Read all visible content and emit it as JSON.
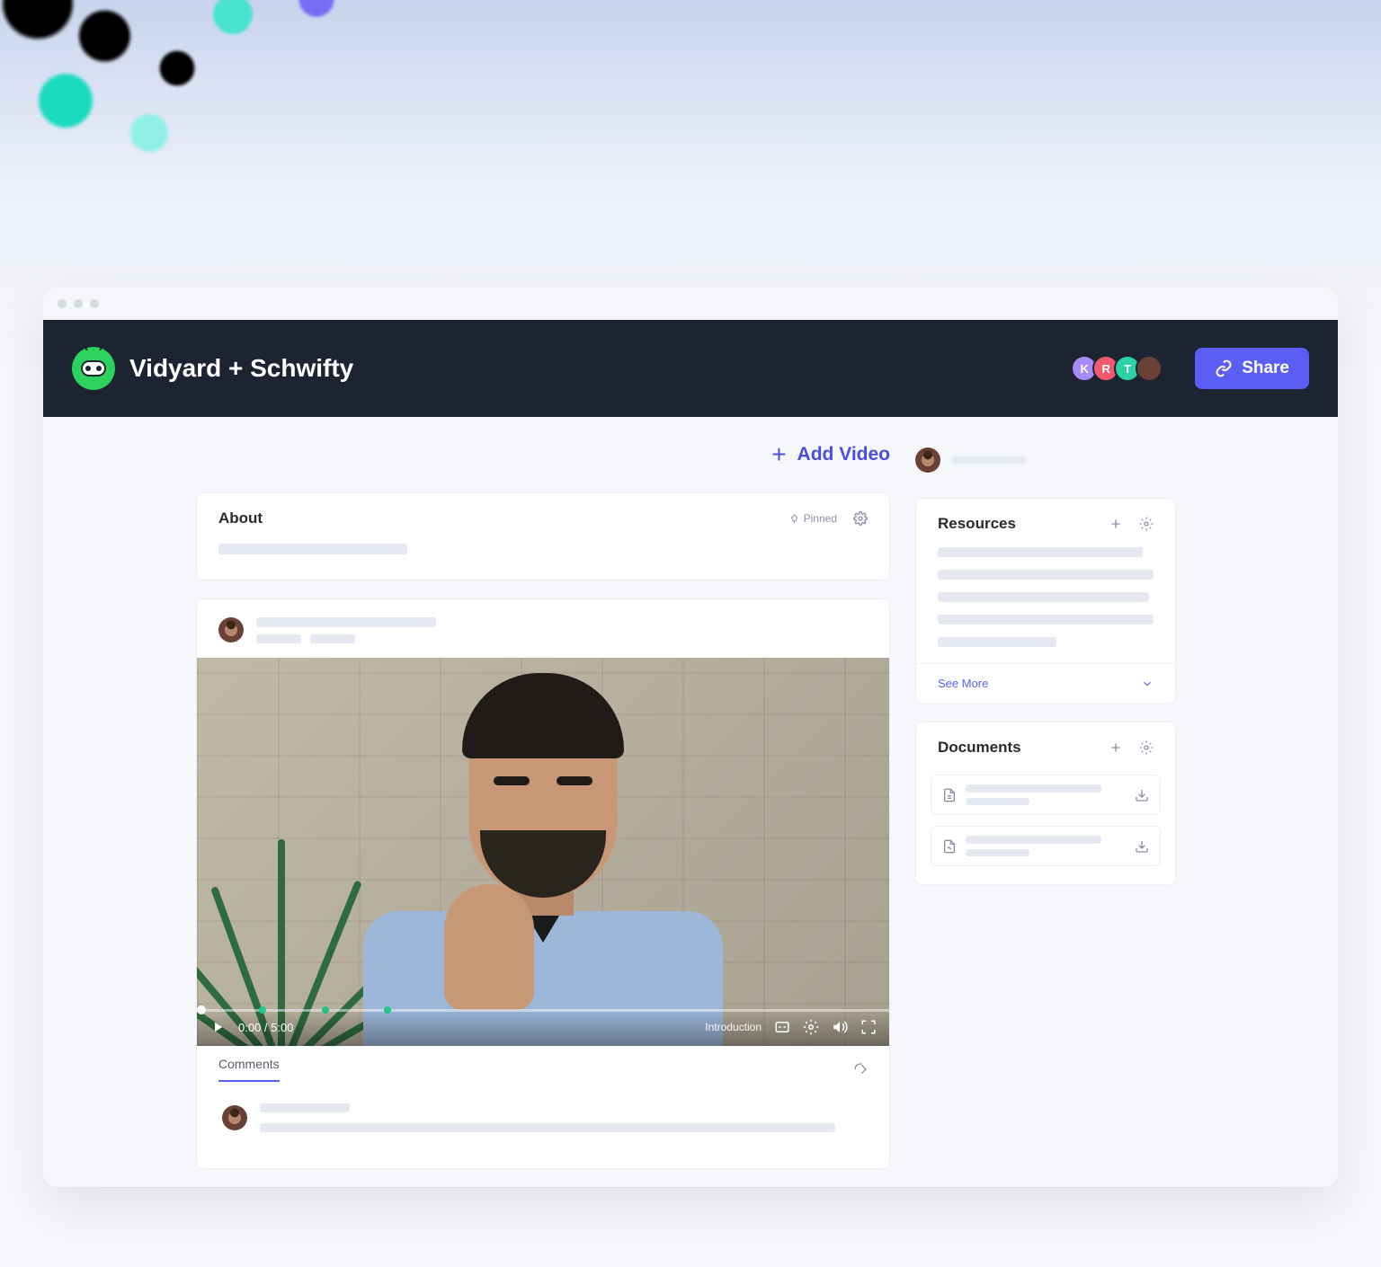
{
  "header": {
    "title": "Vidyard + Schwifty",
    "avatars": [
      "K",
      "R",
      "T"
    ],
    "share_label": "Share"
  },
  "toolbar": {
    "add_video": "Add Video"
  },
  "about_card": {
    "title": "About",
    "pinned_label": "Pinned"
  },
  "video": {
    "time": "0:00 / 5:00",
    "chapter": "Introduction"
  },
  "comments": {
    "tab_label": "Comments"
  },
  "sidebar": {
    "resources": {
      "title": "Resources",
      "see_more": "See More"
    },
    "documents": {
      "title": "Documents"
    }
  }
}
